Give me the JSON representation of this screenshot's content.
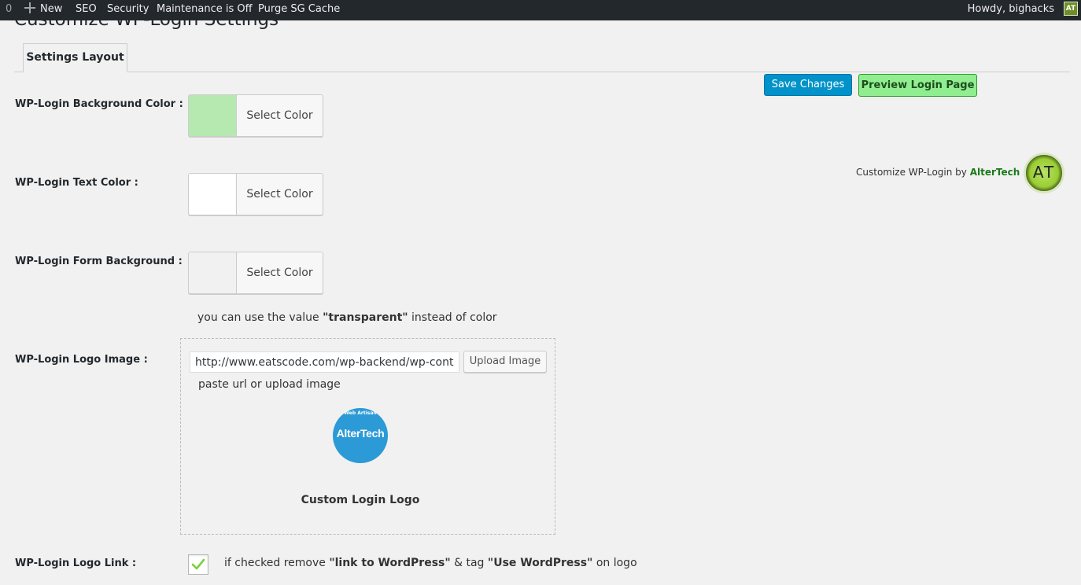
{
  "adminbar": {
    "count": "0",
    "new": "New",
    "seo": "SEO",
    "security": "Security",
    "maintenance": "Maintenance is Off",
    "purge": "Purge SG Cache",
    "howdy": "Howdy, bighacks",
    "avatar_text": "AT"
  },
  "page": {
    "title": "Customize WP-Login Settings"
  },
  "tabs": [
    {
      "label": "Settings Layout"
    }
  ],
  "actions": {
    "save": "Save Changes",
    "preview": "Preview Login Page"
  },
  "credit": {
    "prefix": "Customize WP-Login by ",
    "brand": "AlterTech",
    "logo_text": "AT",
    "brand_color": "#1a7a1a"
  },
  "fields": {
    "bg_color": {
      "label": "WP-Login Background Color :",
      "button": "Select Color",
      "swatch": "#b6e9b0"
    },
    "text_color": {
      "label": "WP-Login Text Color :",
      "button": "Select Color",
      "swatch": "#ffffff"
    },
    "form_bg": {
      "label": "WP-Login Form Background :",
      "button": "Select Color",
      "swatch": "#f1f1f1"
    },
    "transparent_note": {
      "before": "you can use the value ",
      "strong": "\"transparent\"",
      "after": " instead of color"
    },
    "logo_image": {
      "label": "WP-Login Logo Image :",
      "url_value": "http://www.eatscode.com/wp-backend/wp-content",
      "upload": "Upload Image",
      "hint": "paste url or upload image",
      "logo_small": "Web Artisan",
      "logo_main": "AlterTech",
      "caption": "Custom Login Logo",
      "logo_color": "#2b9ad6"
    },
    "logo_link": {
      "label": "WP-Login Logo Link :",
      "checked": true,
      "note_1": "if checked remove ",
      "strong_1": "\"link to WordPress\"",
      "note_2": " & tag ",
      "strong_2": "\"Use WordPress\"",
      "note_3": " on logo"
    }
  },
  "colors": {
    "adminbar": "#23282d",
    "save_button": "#0092c8",
    "preview_button": "#90ee90"
  }
}
